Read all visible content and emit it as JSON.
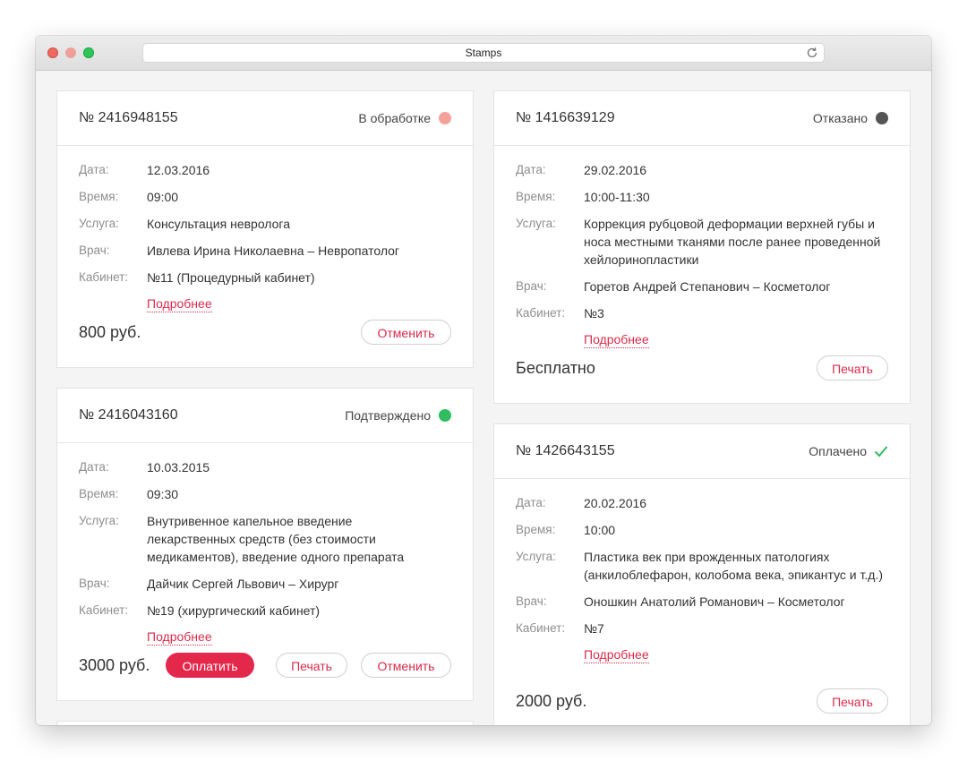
{
  "window": {
    "title": "Stamps"
  },
  "labels": {
    "date": "Дата:",
    "time": "Время:",
    "service": "Услуга:",
    "doctor": "Врач:",
    "room": "Кабинет:",
    "more": "Подробнее"
  },
  "colors": {
    "accent": "#e3284c",
    "status_processing": "#f4a199",
    "status_confirmed": "#2fbd5f",
    "status_refused": "#555555",
    "status_paid": "#2fbd5f"
  },
  "cards": [
    {
      "number": "№ 2416948155",
      "status": "В обработке",
      "date": "12.03.2016",
      "time": "09:00",
      "service": "Консультация невролога",
      "doctor": "Ивлева Ирина Николаевна – Невропатолог",
      "room": "№11 (Процедурный кабинет)",
      "price": "800 руб.",
      "buttons": {
        "cancel": "Отменить"
      }
    },
    {
      "number": "№ 2416043160",
      "status": "Подтверждено",
      "date": "10.03.2015",
      "time": "09:30",
      "service": "Внутривенное капельное введение лекарственных средств (без стоимости медикаментов), введение одного препарата",
      "doctor": "Дайчик Сергей Львович – Хирург",
      "room": "№19 (хирургический кабинет)",
      "price": "3000 руб.",
      "buttons": {
        "pay": "Оплатить",
        "print": "Печать",
        "cancel": "Отменить"
      }
    },
    {
      "number": "№ 1416639129",
      "status": "Отказано",
      "date": "29.02.2016",
      "time": "10:00-11:30",
      "service": "Коррекция рубцовой деформации верхней губы и носа местными тканями после ранее проведенной хейлоринопластики",
      "doctor": "Горетов Андрей Степанович – Косметолог",
      "room": "№3",
      "price": "Бесплатно",
      "buttons": {
        "print": "Печать"
      }
    },
    {
      "number": "№ 1426643155",
      "status": "Оплачено",
      "date": "20.02.2016",
      "time": "10:00",
      "service": "Пластика век при врожденных патологиях (анкилоблефарон, колобома века, эпикантус и т.д.)",
      "doctor": "Оношкин Анатолий Романович – Косметолог",
      "room": "№7",
      "price": "2000 руб.",
      "buttons": {
        "print": "Печать"
      }
    }
  ]
}
